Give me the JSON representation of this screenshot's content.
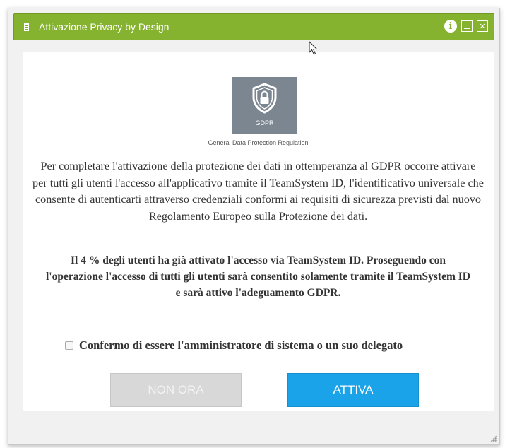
{
  "window": {
    "title": "Attivazione Privacy by Design"
  },
  "titlebar_icons": [
    "document-icon",
    "info-icon",
    "minimize-icon",
    "close-icon"
  ],
  "colors": {
    "titlebar": "#86b32f",
    "primary_button": "#1aa3e8",
    "disabled_button": "#d8d8d8",
    "badge": "#7b8690"
  },
  "badge": {
    "label": "GDPR",
    "caption": "General Data Protection Regulation"
  },
  "body": {
    "paragraph": "Per completare l'attivazione della protezione dei dati in ottemperanza al GDPR occorre attivare per tutti gli utenti l'accesso all'applicativo tramite il TeamSystem ID, l'identificativo universale che consente di autenticarti attraverso credenziali conformi ai requisiti di sicurezza previsti dal nuovo Regolamento Europeo sulla Protezione dei dati.",
    "notice": "Il 4 % degli utenti ha già attivato l'accesso via TeamSystem ID. Proseguendo con l'operazione l'accesso di tutti gli utenti sarà consentito solamente tramite il TeamSystem ID e sarà attivo l'adeguamento GDPR.",
    "confirm_label": "Confermo di essere l'amministratore di sistema o un suo delegato",
    "confirm_checked": false
  },
  "buttons": {
    "later": "NON ORA",
    "activate": "ATTIVA"
  }
}
